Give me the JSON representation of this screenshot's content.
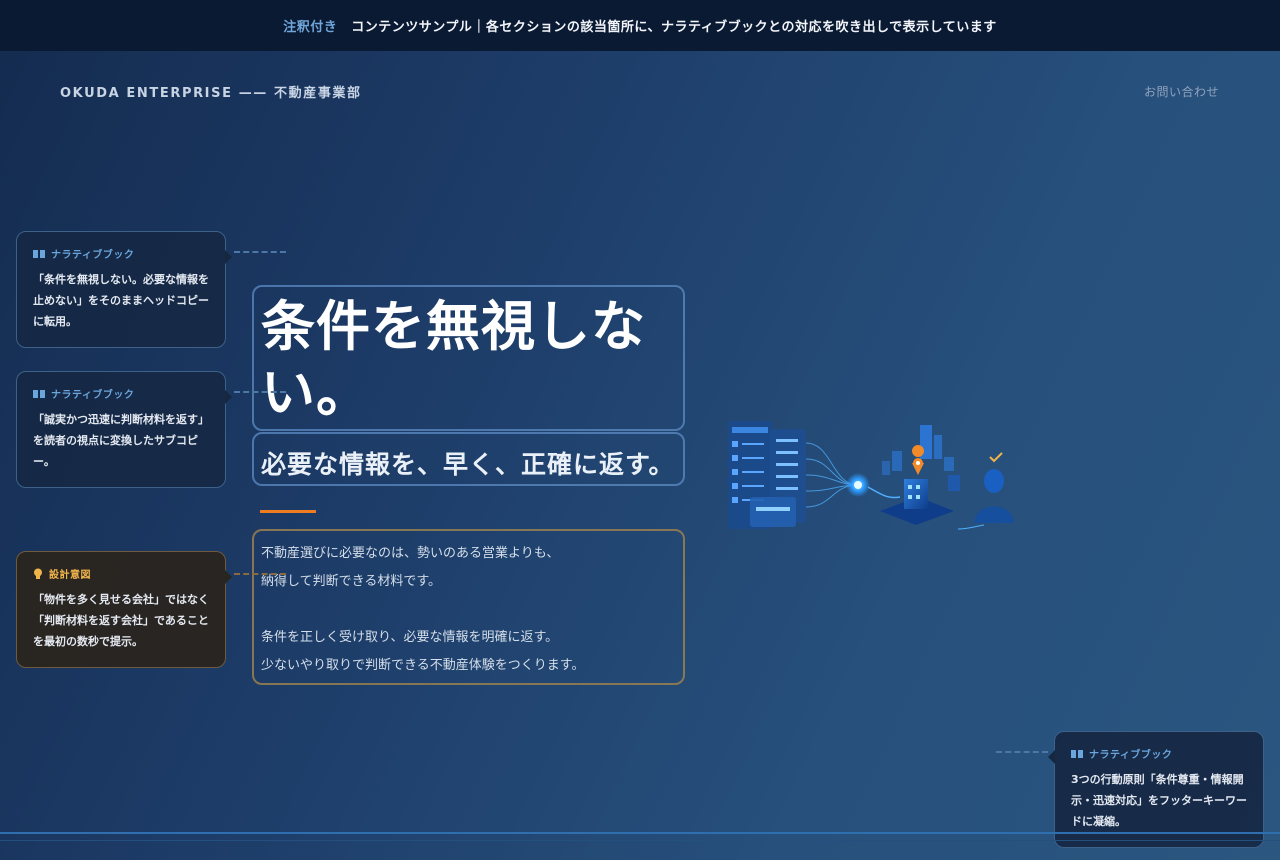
{
  "topbar": {
    "tag": "注釈付き",
    "message": "コンテンツサンプル｜各セクションの該当箇所に、ナラティブブックとの対応を吹き出しで表示しています"
  },
  "header": {
    "brand": "OKUDA ENTERPRISE —— 不動産事業部",
    "contact": "お問い合わせ"
  },
  "hero": {
    "title": "条件を無視しない。",
    "subtitle": "必要な情報を、早く、正確に返す。",
    "lead": [
      "不動産選びに必要なのは、勢いのある営業よりも、",
      "納得して判断できる材料です。",
      "条件を正しく受け取り、必要な情報を明確に返す。",
      "少ないやり取りで判断できる不動産体験をつくります。"
    ]
  },
  "notes": [
    {
      "kind": "narrative",
      "icon": "book-icon",
      "label": "ナラティブブック",
      "text": "「条件を無視しない。必要な情報を止めない」をそのままヘッドコピーに転用。"
    },
    {
      "kind": "narrative",
      "icon": "book-icon",
      "label": "ナラティブブック",
      "text": "「誠実かつ迅速に判断材料を返す」を読者の視点に変換したサブコピー。"
    },
    {
      "kind": "design",
      "icon": "lightbulb-icon",
      "label": "設計意図",
      "text": "「物件を多く見せる会社」ではなく「判断材料を返す会社」であることを最初の数秒で提示。"
    },
    {
      "kind": "narrative",
      "icon": "book-icon",
      "label": "ナラティブブック",
      "text": "3つの行動原則「条件尊重・情報開示・迅速対応」をフッターキーワードに凝縮。"
    }
  ],
  "colors": {
    "accent": "#f07c22",
    "narrative_label": "#6aa5dc",
    "design_label": "#f0b54a",
    "topbar_bg": "#0b1a33"
  }
}
